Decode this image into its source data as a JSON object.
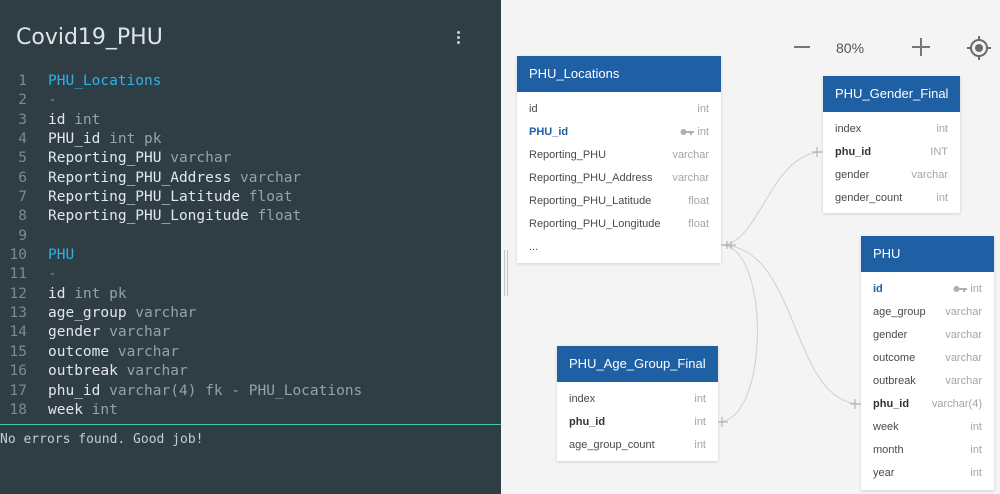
{
  "editor": {
    "title": "Covid19_PHU",
    "lines": [
      {
        "n": "1",
        "parts": [
          {
            "t": "PHU_Locations",
            "c": "table"
          }
        ]
      },
      {
        "n": "2",
        "parts": [
          {
            "t": "-",
            "c": "dash"
          }
        ]
      },
      {
        "n": "3",
        "parts": [
          {
            "t": "id",
            "c": "col"
          },
          {
            "t": " int",
            "c": "type"
          }
        ]
      },
      {
        "n": "4",
        "parts": [
          {
            "t": "PHU_id",
            "c": "col"
          },
          {
            "t": " int pk",
            "c": "type"
          }
        ]
      },
      {
        "n": "5",
        "parts": [
          {
            "t": "Reporting_PHU",
            "c": "col"
          },
          {
            "t": " varchar",
            "c": "type"
          }
        ]
      },
      {
        "n": "6",
        "parts": [
          {
            "t": "Reporting_PHU_Address",
            "c": "col"
          },
          {
            "t": " varchar",
            "c": "type"
          }
        ]
      },
      {
        "n": "7",
        "parts": [
          {
            "t": "Reporting_PHU_Latitude",
            "c": "col"
          },
          {
            "t": " float",
            "c": "type"
          }
        ]
      },
      {
        "n": "8",
        "parts": [
          {
            "t": "Reporting_PHU_Longitude",
            "c": "col"
          },
          {
            "t": " float",
            "c": "type"
          }
        ]
      },
      {
        "n": "9",
        "parts": []
      },
      {
        "n": "10",
        "parts": [
          {
            "t": "PHU",
            "c": "table"
          }
        ]
      },
      {
        "n": "11",
        "parts": [
          {
            "t": "-",
            "c": "dash"
          }
        ]
      },
      {
        "n": "12",
        "parts": [
          {
            "t": "id",
            "c": "col"
          },
          {
            "t": " int pk",
            "c": "type"
          }
        ]
      },
      {
        "n": "13",
        "parts": [
          {
            "t": "age_group",
            "c": "col"
          },
          {
            "t": " varchar",
            "c": "type"
          }
        ]
      },
      {
        "n": "14",
        "parts": [
          {
            "t": "gender",
            "c": "col"
          },
          {
            "t": " varchar",
            "c": "type"
          }
        ]
      },
      {
        "n": "15",
        "parts": [
          {
            "t": "outcome",
            "c": "col"
          },
          {
            "t": " varchar",
            "c": "type"
          }
        ]
      },
      {
        "n": "16",
        "parts": [
          {
            "t": "outbreak",
            "c": "col"
          },
          {
            "t": " varchar",
            "c": "type"
          }
        ]
      },
      {
        "n": "17",
        "parts": [
          {
            "t": "phu_id",
            "c": "col"
          },
          {
            "t": " varchar(4) fk - PHU_Locations",
            "c": "type"
          }
        ]
      },
      {
        "n": "18",
        "parts": [
          {
            "t": "week",
            "c": "col"
          },
          {
            "t": " int",
            "c": "type"
          }
        ]
      }
    ],
    "console": "No errors found. Good job!"
  },
  "toolbar": {
    "zoom_level": "80%"
  },
  "colors": {
    "header": "#1f5fa3",
    "table_keyword": "#2cb3e8",
    "console_divider": "#3ccf9c"
  },
  "tables": {
    "phu_locations": {
      "title": "PHU_Locations",
      "rows": [
        {
          "name": "id",
          "type": "int"
        },
        {
          "name": "PHU_id",
          "type": "int",
          "pk": true
        },
        {
          "name": "Reporting_PHU",
          "type": "varchar"
        },
        {
          "name": "Reporting_PHU_Address",
          "type": "varchar"
        },
        {
          "name": "Reporting_PHU_Latitude",
          "type": "float"
        },
        {
          "name": "Reporting_PHU_Longitude",
          "type": "float"
        },
        {
          "name": "...",
          "type": ""
        }
      ]
    },
    "phu_gender_final": {
      "title": "PHU_Gender_Final",
      "rows": [
        {
          "name": "index",
          "type": "int"
        },
        {
          "name": "phu_id",
          "type": "INT",
          "fk": true
        },
        {
          "name": "gender",
          "type": "varchar"
        },
        {
          "name": "gender_count",
          "type": "int"
        }
      ]
    },
    "phu": {
      "title": "PHU",
      "rows": [
        {
          "name": "id",
          "type": "int",
          "pk": true
        },
        {
          "name": "age_group",
          "type": "varchar"
        },
        {
          "name": "gender",
          "type": "varchar"
        },
        {
          "name": "outcome",
          "type": "varchar"
        },
        {
          "name": "outbreak",
          "type": "varchar"
        },
        {
          "name": "phu_id",
          "type": "varchar(4)",
          "fk": true
        },
        {
          "name": "week",
          "type": "int"
        },
        {
          "name": "month",
          "type": "int"
        },
        {
          "name": "year",
          "type": "int"
        }
      ]
    },
    "phu_age_group_final": {
      "title": "PHU_Age_Group_Final",
      "rows": [
        {
          "name": "index",
          "type": "int"
        },
        {
          "name": "phu_id",
          "type": "int",
          "fk": true
        },
        {
          "name": "age_group_count",
          "type": "int"
        }
      ]
    }
  }
}
